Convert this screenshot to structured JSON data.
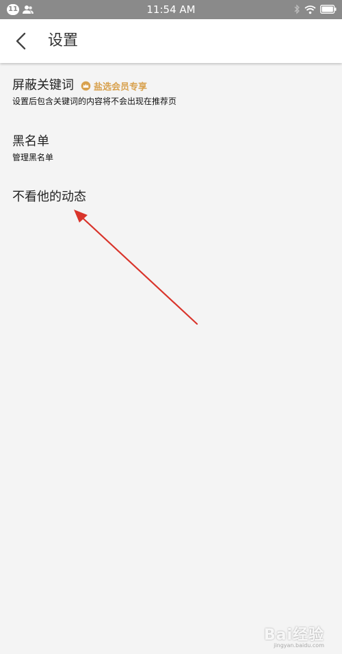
{
  "status_bar": {
    "notification_count": "11",
    "time": "11:54 AM",
    "icons": [
      "people-icon",
      "bluetooth-icon",
      "wifi-icon",
      "battery-icon"
    ]
  },
  "header": {
    "back_icon": "chevron-left-icon",
    "title": "设置"
  },
  "settings": {
    "keywords": {
      "title": "屏蔽关键词",
      "badge": "盐选会员专享",
      "badge_color": "#d8a14e",
      "subtitle": "设置后包含关键词的内容将不会出现在推荐页"
    },
    "blacklist": {
      "title": "黑名单",
      "subtitle": "管理黑名单"
    },
    "hide_feed": {
      "title": "不看他的动态"
    }
  },
  "annotation": {
    "arrow_color": "#d9342b"
  },
  "watermark": {
    "text": "Bai经验",
    "url": "jingyan.baidu.com"
  }
}
